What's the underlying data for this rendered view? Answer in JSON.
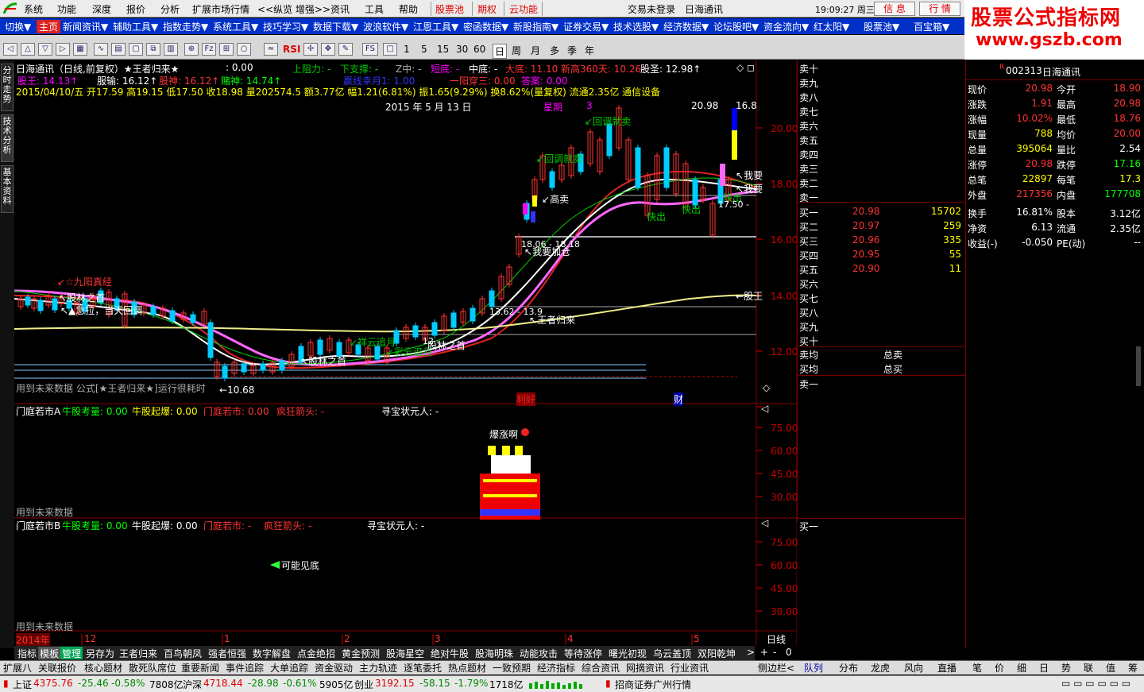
{
  "menu": {
    "items": [
      "系统",
      "功能",
      "深度",
      "报价",
      "分析",
      "扩展市场行情",
      "<<纵览 增强>>",
      "资讯",
      "工具",
      "帮助"
    ],
    "red_items": [
      "股票池",
      "期权",
      "云功能"
    ],
    "login": "交易未登录",
    "stock": "日海通讯",
    "clock": "19:09:27 周三",
    "btn_xinyi": "信 息",
    "btn_hangqing": "行 情"
  },
  "brand": {
    "line1": "股票公式指标网",
    "line2": "www.gszb.com"
  },
  "nav": {
    "items": [
      "切换▼",
      "主页",
      "新闻资讯▼",
      "辅助工具▼",
      "指数走势▼",
      "系统工具▼",
      "技巧学习▼",
      "数据下载▼",
      "波浪软件▼",
      "江恩工具▼",
      "密函数据▼",
      "新股指南▼",
      "证券交易▼",
      "技术选股▼",
      "经济数据▼",
      "论坛股吧▼",
      "资金流向▼",
      "红太阳▼",
      "股票池▼",
      "百宝箱▼"
    ]
  },
  "toolbar": {
    "periods": [
      "1",
      "5",
      "15",
      "30",
      "60",
      "日",
      "周",
      "月",
      "多",
      "季",
      "年"
    ],
    "rsi": "RSI",
    "fs": "FS"
  },
  "lefttabs": [
    "分时走势",
    "技术分析",
    "基本资料"
  ],
  "main": {
    "title": "日海通讯（日线,前复权）★王者归来★",
    "title_val": ": 0.00",
    "zuli": "上阻力: -",
    "xiazhi": "下支撑: -",
    "zzhong": "Z中: -",
    "duandi": "短底: -",
    "zhongdi": "中底: -",
    "dadi": "大底: 11.10",
    "xingao": "新高360天: 10.26",
    "gusheng": "股圣: 12.98↑",
    "guwang": "股王: 14.13↑",
    "fushu": "服输: 16.12↑",
    "gushen": "股神: 16.12↑",
    "dushen": "赌神: 14.74↑",
    "rusi": "赢线幸月1: 1.00",
    "yiyang": "一阳穿三: 0.00",
    "daan": "答案: 0.00",
    "ohlc": "2015/04/10/五 开17.59 高19.15 低17.50 收18.98 量202574.5 额3.77亿 幅1.21(6.81%) 振1.65(9.29%) 换8.62%(量复权) 流通2.35亿 通信设备",
    "date_label": "2015 年 5 月 13 日",
    "xingqi": "星期",
    "xingqi_num": "3",
    "top_price": "20.98",
    "top_price2": "16.8",
    "annotations": [
      "回调就卖",
      "回调就卖",
      "高卖",
      "我要加仓",
      "王者归来",
      "九阳真经",
      "股林之首",
      "急拉，当天回调",
      "祥云追月",
      "股林之首",
      "彩云追月",
      "股林之首",
      "我要",
      "我要",
      "快出",
      "快出",
      "快出",
      "股王"
    ],
    "levels": [
      "18.06 - 18.18",
      "13.62 - 13.9",
      "12 -",
      "17.50 -"
    ],
    "low_label": "10.68",
    "future_note": "用到未来数据 公式[★王者归来★]运行很耗时",
    "markers": [
      "利好",
      "财"
    ],
    "yaxis": [
      "20.00",
      "18.00",
      "16.00",
      "14.00",
      "12.00"
    ]
  },
  "pane2": {
    "title": "门庭若市A",
    "a": "牛股考量: 0.00",
    "b": "牛股起爆: 0.00",
    "c": "门庭若市: 0.00",
    "d": "疯狂箭头: -",
    "e": "寻宝状元人: -",
    "note": "用到未来数据",
    "yaxis": [
      "75.00",
      "60.00",
      "45.00",
      "30.00"
    ],
    "bubble": "爆涨啊"
  },
  "pane3": {
    "title": "门庭若市B",
    "a": "牛股考量: 0.00",
    "b": "牛股起爆: 0.00",
    "c": "门庭若市: -",
    "d": "疯狂箭头: -",
    "e": "寻宝状元人: -",
    "note": "用到未来数据",
    "yaxis": [
      "75.00",
      "60.00",
      "45.00",
      "30.00"
    ],
    "signal": "可能见底"
  },
  "xaxis": {
    "labels": [
      "2014年",
      "12",
      "1",
      "2",
      "3",
      "4",
      "5"
    ],
    "period": "日线"
  },
  "orderbook": {
    "sell": [
      "卖十",
      "卖九",
      "卖八",
      "卖七",
      "卖六",
      "卖五",
      "卖四",
      "卖三",
      "卖二",
      "卖一"
    ],
    "buy": [
      {
        "l": "买一",
        "p": "20.98",
        "v": "15702"
      },
      {
        "l": "买二",
        "p": "20.97",
        "v": "259"
      },
      {
        "l": "买三",
        "p": "20.96",
        "v": "335"
      },
      {
        "l": "买四",
        "p": "20.95",
        "v": "55"
      },
      {
        "l": "买五",
        "p": "20.90",
        "v": "11"
      },
      {
        "l": "买六"
      },
      {
        "l": "买七"
      },
      {
        "l": "买八"
      },
      {
        "l": "买九"
      },
      {
        "l": "买十"
      }
    ],
    "avg_sell": "卖均",
    "total_sell": "总卖",
    "avg_buy": "买均",
    "total_buy": "总买",
    "sell1b": "卖一",
    "buy1b": "买一"
  },
  "quote": {
    "code": "002313",
    "name": "日海通讯",
    "rows": [
      [
        "现价",
        "20.98",
        "今开",
        "18.90"
      ],
      [
        "涨跌",
        "1.91",
        "最高",
        "20.98"
      ],
      [
        "涨幅",
        "10.02%",
        "最低",
        "18.76"
      ],
      [
        "现量",
        "788",
        "均价",
        "20.00"
      ],
      [
        "总量",
        "395064",
        "量比",
        "2.54"
      ],
      [
        "涨停",
        "20.98",
        "跌停",
        "17.16"
      ],
      [
        "总笔",
        "22897",
        "每笔",
        "17.3"
      ],
      [
        "外盘",
        "217356",
        "内盘",
        "177708"
      ],
      [
        "换手",
        "16.81%",
        "股本",
        "3.12亿"
      ],
      [
        "净资",
        "6.13",
        "流通",
        "2.35亿"
      ],
      [
        "收益(-)",
        "-0.050",
        "PE(动)",
        "--"
      ]
    ]
  },
  "tabs1": [
    "指标",
    "模板",
    "管理",
    "另存为",
    "王者归来",
    "百鸟朝凤",
    "强者恒强",
    "数字解盘",
    "点金绝招",
    "黄金预测",
    "股海星空",
    "绝对牛股",
    "股海明珠",
    "动能攻击",
    "等待涨停",
    "曙光初现",
    "乌云盖顶",
    "双阳乾坤"
  ],
  "tabs2": [
    "扩展八",
    "关联报价",
    "核心题材",
    "散死队席位",
    "重要新闻",
    "事件追踪",
    "大单追踪",
    "资金驱动",
    "主力轨迹",
    "逐笔委托",
    "热点题材",
    "一致预期",
    "经济指标",
    "综合资讯",
    "网摘资讯",
    "行业资讯"
  ],
  "side_tabs": [
    "侧边栏<",
    "队列",
    "分布",
    "龙虎",
    "风向",
    "直播",
    "笔",
    "价",
    "细",
    "日",
    "势",
    "联",
    "值",
    "筹"
  ],
  "status": {
    "sh": "上证",
    "sh_v": "4375.76",
    "sh_c": "-25.46",
    "sh_p": "-0.58%",
    "sh_a": "7808亿",
    "sz": "沪深",
    "sz_v": "4718.44",
    "sz_c": "-28.98",
    "sz_p": "-0.61%",
    "sz_a": "5905亿",
    "cy": "创业",
    "cy_v": "3192.15",
    "cy_c": "-58.15",
    "cy_p": "-1.79%",
    "cy_a": "1718亿",
    "broker": "招商证券广州行情"
  }
}
